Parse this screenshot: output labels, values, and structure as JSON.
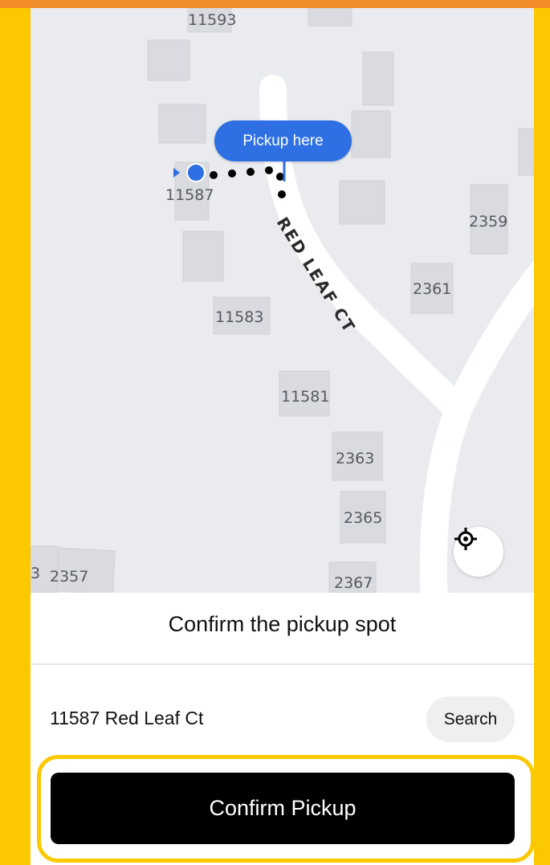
{
  "map": {
    "street_name": "RED LEAF CT",
    "building_labels": [
      "11593",
      "11587",
      "2359",
      "2361",
      "11583",
      "11581",
      "2363",
      "2365",
      "3",
      "2357",
      "2367"
    ],
    "pickup_bubble_label": "Pickup here",
    "locate_icon": "crosshair-icon",
    "current_location_icon": "blue-dot-icon"
  },
  "sheet": {
    "title": "Confirm the pickup spot",
    "address": "11587 Red Leaf Ct",
    "search_label": "Search",
    "confirm_label": "Confirm Pickup"
  },
  "colors": {
    "frame_orange": "#f28c28",
    "frame_yellow": "#fcc800",
    "map_background": "#e9ebee",
    "road": "#ffffff",
    "pickup_blue": "#2e6fe4",
    "confirm_button": "#000000"
  }
}
